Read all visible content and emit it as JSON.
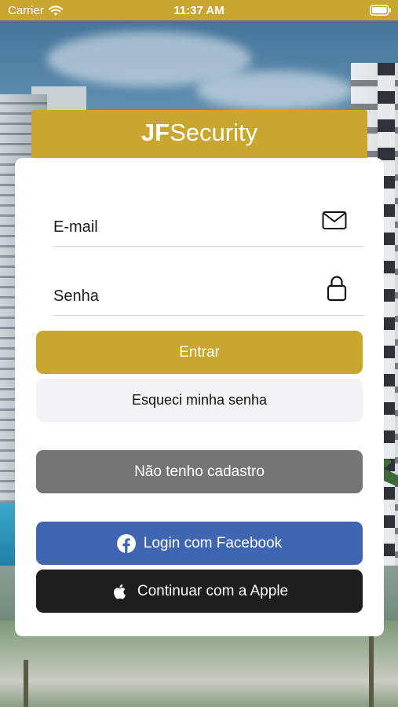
{
  "status_bar": {
    "carrier": "Carrier",
    "time": "11:37 AM"
  },
  "header": {
    "brand_bold": "JF",
    "brand_rest": "Security"
  },
  "form": {
    "email_placeholder": "E-mail",
    "password_placeholder": "Senha"
  },
  "buttons": {
    "login": "Entrar",
    "forgot_password": "Esqueci minha senha",
    "register": "Não tenho cadastro",
    "facebook": "Login com Facebook",
    "apple": "Continuar com a Apple"
  },
  "icons": {
    "wifi": "wifi-icon",
    "battery": "battery-icon",
    "email": "mail-icon",
    "password": "lock-icon",
    "facebook": "facebook-icon",
    "apple": "apple-icon"
  },
  "colors": {
    "brand_gold": "#c9a630",
    "facebook_blue": "#4066b2",
    "apple_black": "#1e1e1e",
    "register_gray": "#757575",
    "forgot_bg": "#f2f3f7"
  }
}
